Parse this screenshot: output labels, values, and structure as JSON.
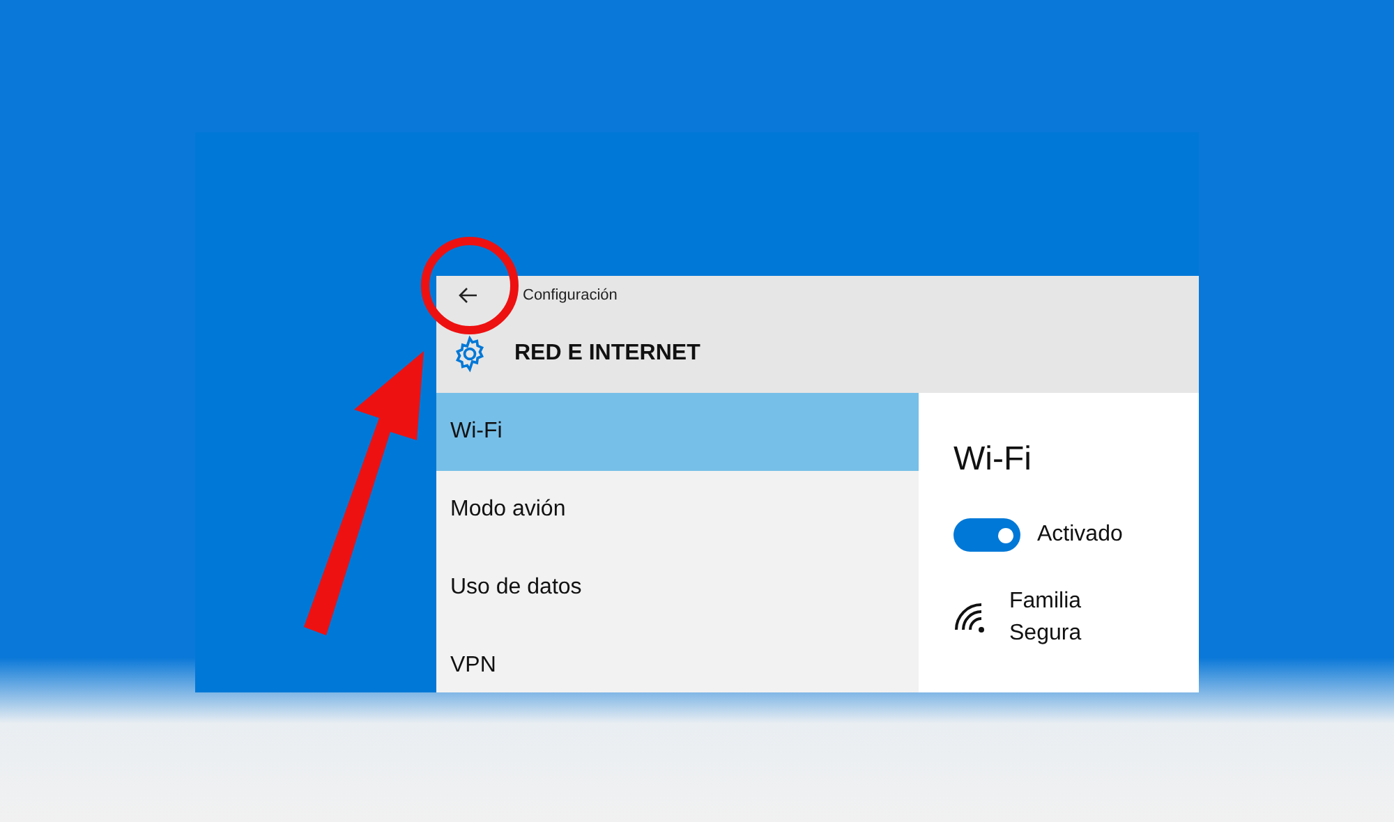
{
  "window": {
    "title": "Configuración"
  },
  "header": {
    "title": "RED E INTERNET"
  },
  "sidebar": {
    "items": [
      {
        "label": "Wi-Fi",
        "selected": true
      },
      {
        "label": "Modo avión",
        "selected": false
      },
      {
        "label": "Uso de datos",
        "selected": false
      },
      {
        "label": "VPN",
        "selected": false
      }
    ]
  },
  "pane": {
    "title": "Wi-Fi",
    "toggle": {
      "on": true,
      "label": "Activado"
    },
    "network": {
      "name": "Familia Segura"
    }
  }
}
